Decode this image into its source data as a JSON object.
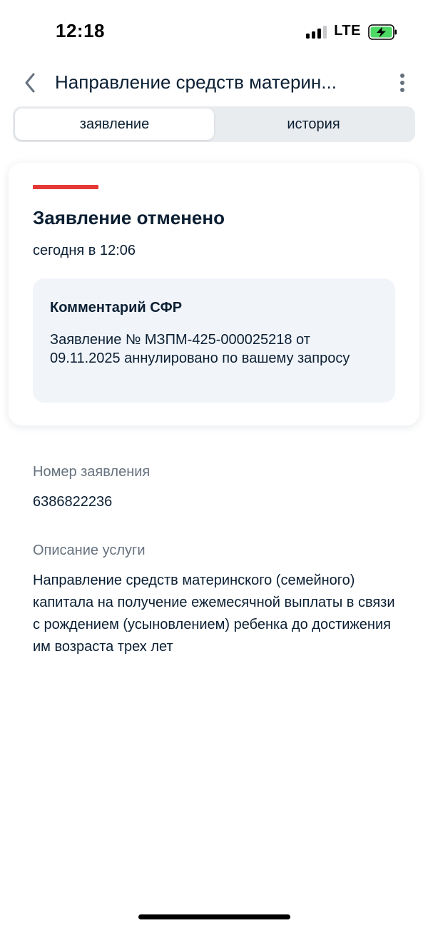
{
  "status_bar": {
    "time": "12:18",
    "network": "LTE",
    "signal_bars_filled": 3,
    "signal_bars_total": 4,
    "battery_state": "charging"
  },
  "header": {
    "title": "Направление средств материн...",
    "back_icon": "chevron-left-icon",
    "more_icon": "more-vertical-icon"
  },
  "tabs": [
    {
      "label": "заявление",
      "active": true
    },
    {
      "label": "история",
      "active": false
    }
  ],
  "status_card": {
    "accent_color": "#e53935",
    "title": "Заявление отменено",
    "time": "сегодня в 12:06",
    "comment": {
      "title": "Комментарий СФР",
      "text": "Заявление № МЗПМ-425-000025218 от 09.11.2025 аннулировано по вашему запросу"
    }
  },
  "details": {
    "number_label": "Номер заявления",
    "number_value": "6386822236",
    "description_label": "Описание услуги",
    "description_value": "Направление средств материнского (семейного) капитала на получение ежемесячной выплаты в связи с рождением (усыновлением) ребенка до достижения им возраста трех лет"
  },
  "colors": {
    "text_primary": "#0b1f33",
    "text_secondary": "#66727f",
    "comment_bg": "#f1f4f9",
    "tabs_bg": "#e9ecef"
  }
}
